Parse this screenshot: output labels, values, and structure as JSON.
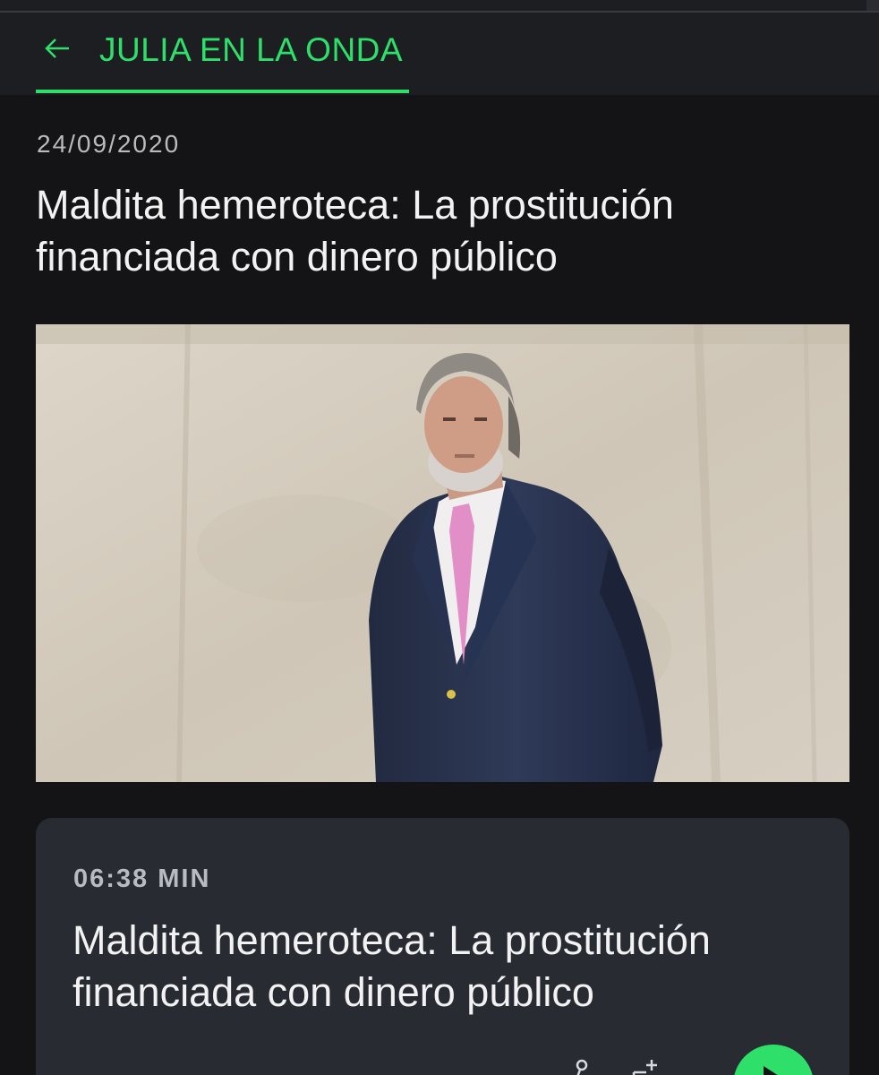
{
  "header": {
    "back_icon": "arrow-left-icon",
    "section_title": "JULIA EN LA ONDA",
    "accent_color": "#2ee06a"
  },
  "article": {
    "date": "24/09/2020",
    "headline": "Maldita hemeroteca: La prostitución financiada con dinero público"
  },
  "audio_card": {
    "duration": "06:38 MIN",
    "title": "Maldita hemeroteca: La prostitución financiada con dinero público",
    "icons": [
      "share-icon",
      "add-to-playlist-icon",
      "play-icon"
    ]
  }
}
